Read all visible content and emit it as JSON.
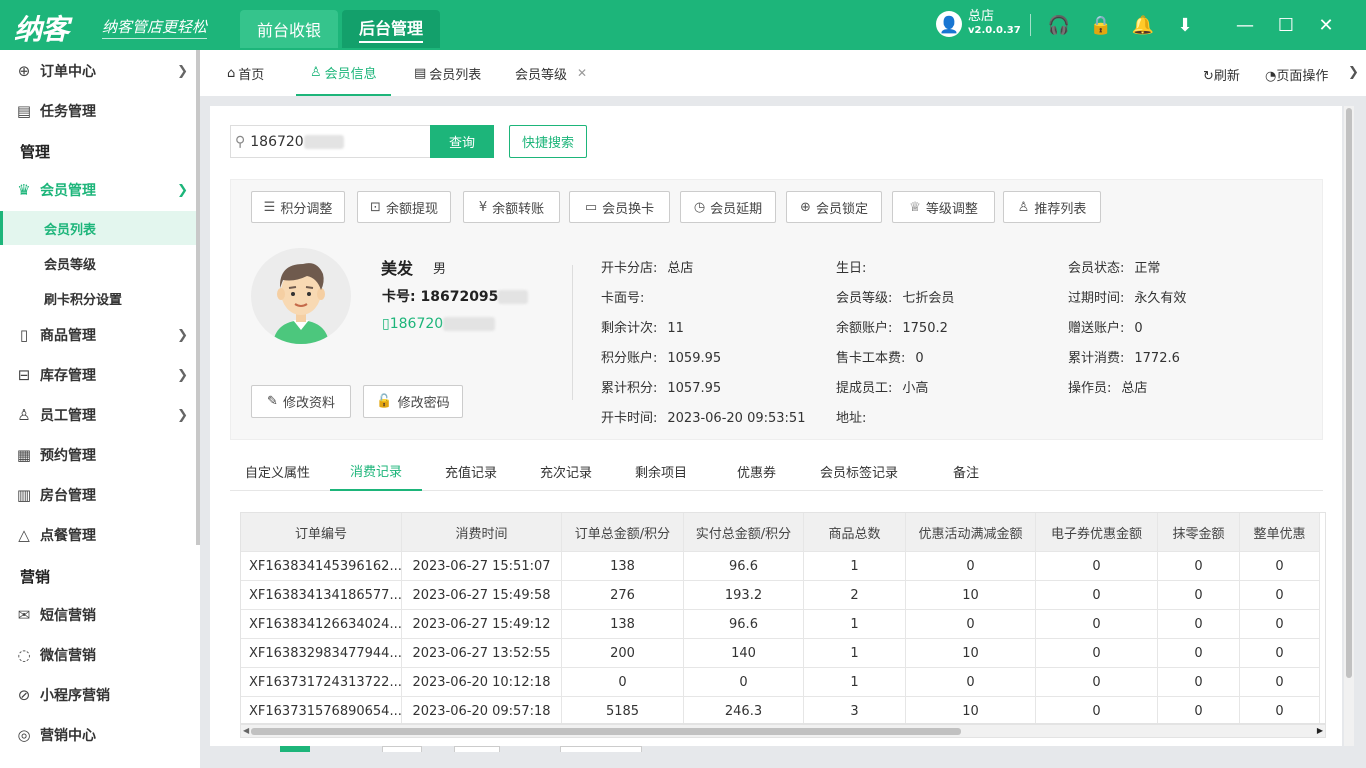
{
  "app": {
    "logo": "纳客",
    "slogan": "纳客管店更轻松"
  },
  "top_tabs": [
    {
      "label": "前台收银"
    },
    {
      "label": "后台管理"
    }
  ],
  "user": {
    "name": "总店",
    "version": "v2.0.0.37"
  },
  "top_icons": [
    "headset-icon",
    "lock-icon",
    "bell-icon",
    "download-icon",
    "minimize-icon",
    "maximize-icon",
    "close-icon"
  ],
  "sidebar": {
    "items": [
      {
        "label": "订单中心",
        "icon": "globe-icon"
      },
      {
        "label": "任务管理",
        "icon": "task-icon"
      },
      {
        "group": "管理"
      },
      {
        "label": "会员管理",
        "icon": "crown-icon"
      },
      {
        "label": "会员列表"
      },
      {
        "label": "会员等级"
      },
      {
        "label": "刷卡积分设置"
      },
      {
        "label": "商品管理",
        "icon": "goods-icon"
      },
      {
        "label": "库存管理",
        "icon": "inventory-icon"
      },
      {
        "label": "员工管理",
        "icon": "staff-icon"
      },
      {
        "label": "预约管理",
        "icon": "calendar-icon"
      },
      {
        "label": "房台管理",
        "icon": "room-icon"
      },
      {
        "label": "点餐管理",
        "icon": "dish-icon"
      },
      {
        "group": "营销"
      },
      {
        "label": "短信营销",
        "icon": "sms-icon"
      },
      {
        "label": "微信营销",
        "icon": "wechat-icon"
      },
      {
        "label": "小程序营销",
        "icon": "miniapp-icon"
      },
      {
        "label": "营销中心",
        "icon": "target-icon"
      }
    ]
  },
  "page_tabs": [
    {
      "label": "首页"
    },
    {
      "label": "会员信息"
    },
    {
      "label": "会员列表"
    },
    {
      "label": "会员等级"
    }
  ],
  "page_actions": {
    "refresh": "刷新",
    "page_ops": "页面操作"
  },
  "search": {
    "value": "186720",
    "query_btn": "查询",
    "quick_btn": "快捷搜索"
  },
  "actions": [
    "积分调整",
    "余额提现",
    "余额转账",
    "会员换卡",
    "会员延期",
    "会员锁定",
    "等级调整",
    "推荐列表"
  ],
  "member": {
    "name": "美发",
    "sex": "男",
    "card_label": "卡号:",
    "card_no": "18672095",
    "phone": "186720",
    "edit_profile": "修改资料",
    "edit_password": "修改密码"
  },
  "fields": [
    {
      "label": "开卡分店:",
      "value": "总店"
    },
    {
      "label": "生日:",
      "value": ""
    },
    {
      "label": "会员状态:",
      "value": "正常"
    },
    {
      "label": "卡面号:",
      "value": ""
    },
    {
      "label": "会员等级:",
      "value": "七折会员"
    },
    {
      "label": "过期时间:",
      "value": "永久有效"
    },
    {
      "label": "剩余计次:",
      "value": "11"
    },
    {
      "label": "余额账户:",
      "value": "1750.2"
    },
    {
      "label": "赠送账户:",
      "value": "0"
    },
    {
      "label": "积分账户:",
      "value": "1059.95"
    },
    {
      "label": "售卡工本费:",
      "value": "0"
    },
    {
      "label": "累计消费:",
      "value": "1772.6"
    },
    {
      "label": "累计积分:",
      "value": "1057.95"
    },
    {
      "label": "提成员工:",
      "value": "小高"
    },
    {
      "label": "操作员:",
      "value": "总店"
    },
    {
      "label": "开卡时间:",
      "value": "2023-06-20 09:53:51"
    },
    {
      "label": "地址:",
      "value": ""
    }
  ],
  "sub_tabs": [
    "自定义属性",
    "消费记录",
    "充值记录",
    "充次记录",
    "剩余项目",
    "优惠券",
    "会员标签记录",
    "备注"
  ],
  "table": {
    "columns": [
      "订单编号",
      "消费时间",
      "订单总金额/积分",
      "实付总金额/积分",
      "商品总数",
      "优惠活动满减金额",
      "电子券优惠金额",
      "抹零金额",
      "整单优惠"
    ],
    "rows": [
      [
        "XF163834145396162...",
        "2023-06-27 15:51:07",
        "138",
        "96.6",
        "1",
        "0",
        "0",
        "0",
        "0"
      ],
      [
        "XF163834134186577...",
        "2023-06-27 15:49:58",
        "276",
        "193.2",
        "2",
        "10",
        "0",
        "0",
        "0"
      ],
      [
        "XF163834126634024...",
        "2023-06-27 15:49:12",
        "138",
        "96.6",
        "1",
        "0",
        "0",
        "0",
        "0"
      ],
      [
        "XF163832983477944...",
        "2023-06-27 13:52:55",
        "200",
        "140",
        "1",
        "10",
        "0",
        "0",
        "0"
      ],
      [
        "XF163731724313722...",
        "2023-06-20 10:12:18",
        "0",
        "0",
        "1",
        "0",
        "0",
        "0",
        "0"
      ],
      [
        "XF163731576890654...",
        "2023-06-20 09:57:18",
        "5185",
        "246.3",
        "3",
        "10",
        "0",
        "0",
        "0"
      ]
    ]
  }
}
